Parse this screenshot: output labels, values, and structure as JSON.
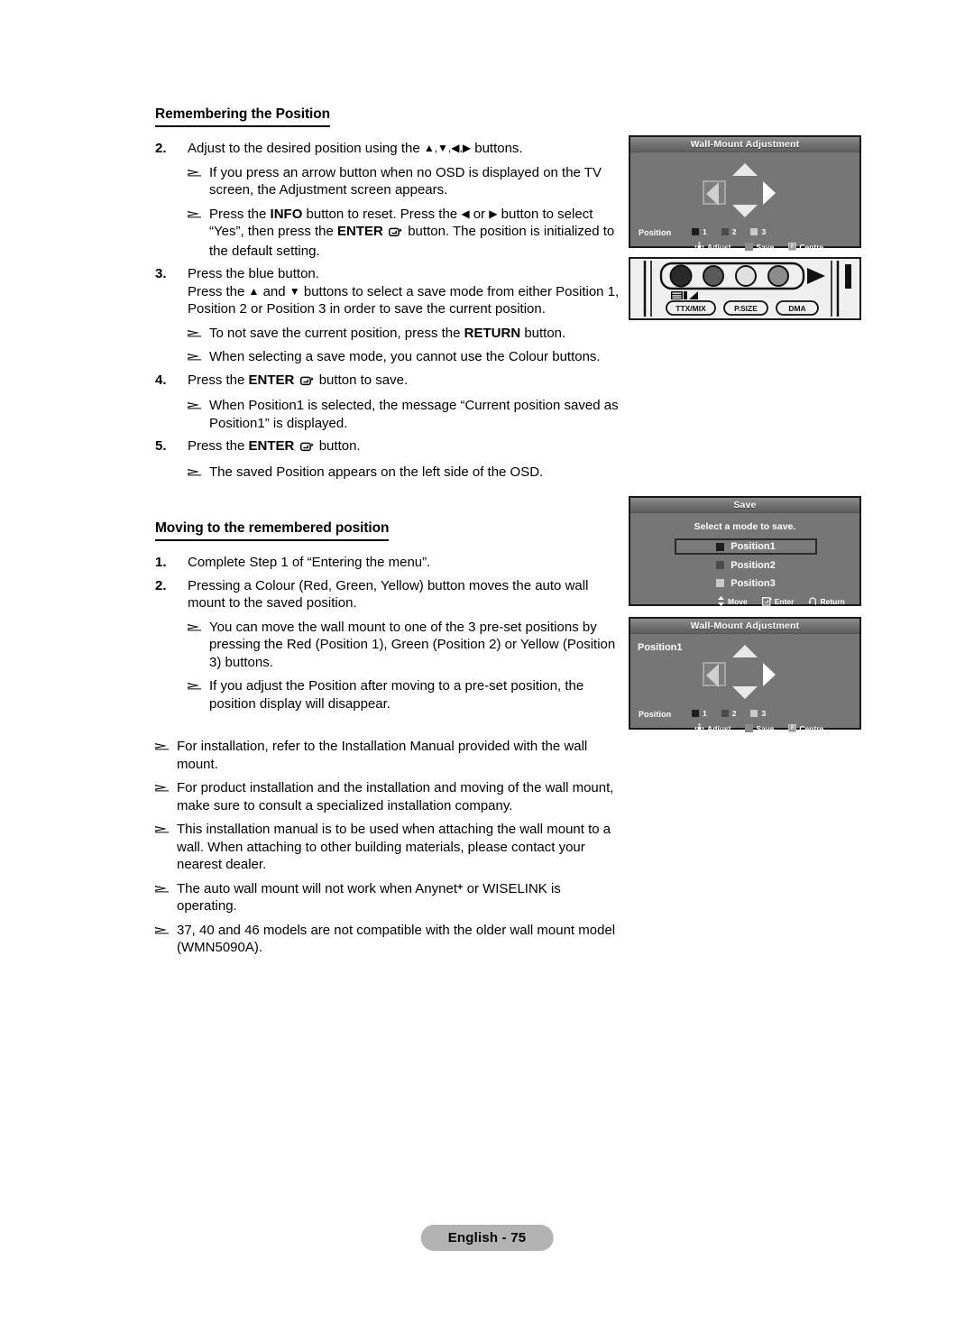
{
  "document": {
    "section1_heading": "Remembering the Position",
    "section2_heading": "Moving to the remembered position",
    "page_badge": "English - 75"
  },
  "section1": {
    "steps": [
      {
        "num": "2.",
        "text_parts": [
          "Adjust to the desired position using the ",
          "▲,▼,◀,▶",
          " buttons."
        ],
        "bullets": [
          "If you press an arrow button when no OSD is displayed on the TV screen, the Adjustment screen appears.",
          "Press the INFO button to reset. Press the ◀ or ▶ button to select “Yes”, then press the ENTER ↵ button. The position is initialized to the default setting."
        ]
      },
      {
        "num": "3.",
        "line1": "Press the blue button.",
        "line2": "Press the ▲ and ▼ buttons to select a save mode from either Position 1, Position 2 or Position 3 in order to save the current position.",
        "bullets": [
          "To not save the current position, press the RETURN button.",
          "When selecting a save mode, you cannot use the Colour buttons."
        ]
      },
      {
        "num": "4.",
        "text": "Press the ENTER ↵ button to save.",
        "bullets": [
          "When Position1 is selected, the message “Current position saved as Position1” is displayed."
        ]
      },
      {
        "num": "5.",
        "text": "Press the ENTER ↵ button.",
        "bullets": [
          "The saved Position appears on the left side of the OSD."
        ]
      }
    ]
  },
  "section2": {
    "steps": [
      {
        "num": "1.",
        "text": "Complete Step 1 of “Entering the menu”.",
        "bullets": []
      },
      {
        "num": "2.",
        "text": "Pressing a Colour (Red, Green, Yellow) button moves the auto wall mount to the saved position.",
        "bullets": [
          "You can move the wall mount to one of the 3 pre-set positions by pressing the Red (Position 1), Green (Position 2) or Yellow (Position 3) buttons.",
          "If you adjust the Position after moving to a pre-set position, the position display will disappear."
        ]
      }
    ],
    "notes": [
      "For installation, refer to the Installation Manual provided with the wall mount.",
      "For product installation and the installation and moving of the wall mount, make sure to consult a specialized installation company.",
      "This installation manual is to be used when attaching the wall mount to a wall. When attaching to other building materials, please contact your nearest dealer.",
      "The auto wall mount will not work when Anynet+ or WISELINK is operating.",
      "37, 40 and 46 models are not compatible with the older wall mount model (WMN5090A)."
    ]
  },
  "osd_top": {
    "title": "Wall-Mount Adjustment",
    "position_label": "Position",
    "position_items": [
      {
        "label": "1",
        "color": "#1d1d1d"
      },
      {
        "label": "2",
        "color": "#4a4a4a"
      },
      {
        "label": "3",
        "color": "#c9c9c9"
      }
    ],
    "footer": [
      {
        "key": "dpad",
        "label": "Adjust"
      },
      {
        "key": "blank",
        "label": "Save"
      },
      {
        "key": "F",
        "label": "Centre"
      }
    ]
  },
  "osd_save": {
    "title": "Save",
    "prompt": "Select a mode to save.",
    "options": [
      {
        "label": "Position1",
        "color": "#1d1d1d",
        "selected": true
      },
      {
        "label": "Position2",
        "color": "#4a4a4a",
        "selected": false
      },
      {
        "label": "Position3",
        "color": "#c9c9c9",
        "selected": false
      }
    ],
    "footer": [
      {
        "key": "updown",
        "label": "Move"
      },
      {
        "key": "enter",
        "label": "Enter"
      },
      {
        "key": "return",
        "label": "Return"
      }
    ]
  },
  "osd_bottom": {
    "title": "Wall-Mount Adjustment",
    "saved_position": "Position1",
    "position_label": "Position",
    "position_items": [
      {
        "label": "1",
        "color": "#1d1d1d"
      },
      {
        "label": "2",
        "color": "#4a4a4a"
      },
      {
        "label": "3",
        "color": "#c9c9c9"
      }
    ],
    "footer": [
      {
        "key": "dpad",
        "label": "Adjust"
      },
      {
        "key": "blank",
        "label": "Save"
      },
      {
        "key": "F",
        "label": "Centre"
      }
    ]
  },
  "remote_panel": {
    "buttons": [
      {
        "name": "red-button",
        "color": "#2a2a2a"
      },
      {
        "name": "green-button",
        "color": "#5a5a5a"
      },
      {
        "name": "yellow-button",
        "color": "#e0e0e0"
      },
      {
        "name": "blue-button",
        "color": "#8c8c8c"
      }
    ],
    "labels": [
      "TTX/MIX",
      "P.SIZE",
      "DMA"
    ]
  }
}
